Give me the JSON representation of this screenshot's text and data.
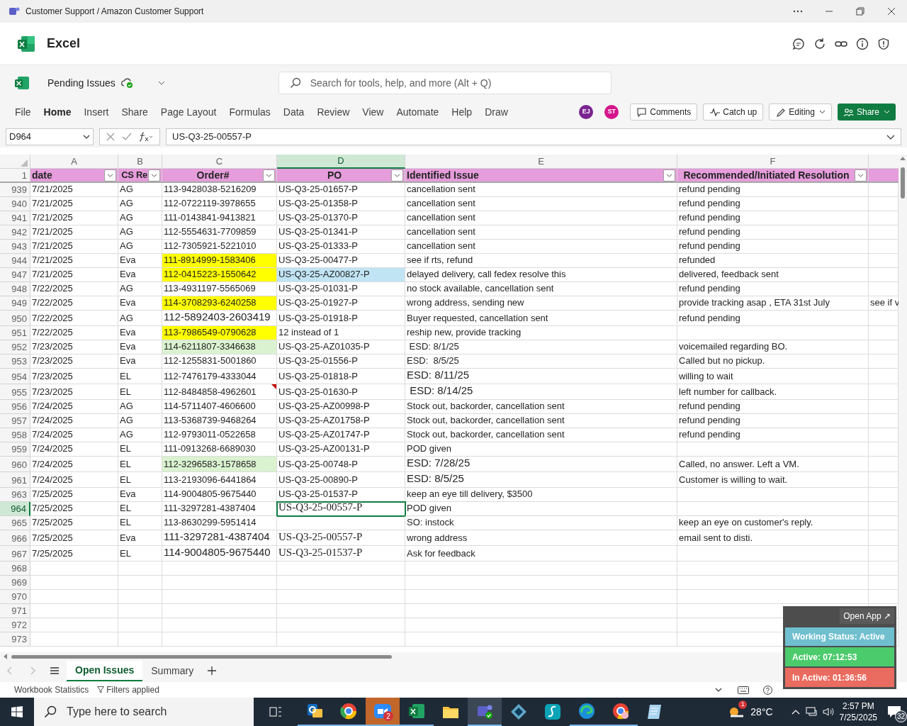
{
  "title_bar": {
    "title": "Customer Support / Amazon Customer Support"
  },
  "app": {
    "name": "Excel"
  },
  "document": {
    "name": "Pending Issues"
  },
  "search": {
    "placeholder": "Search for tools, help, and more (Alt + Q)"
  },
  "menu": [
    {
      "label": "File",
      "selected": false
    },
    {
      "label": "Home",
      "selected": true
    },
    {
      "label": "Insert",
      "selected": false
    },
    {
      "label": "Share",
      "selected": false
    },
    {
      "label": "Page Layout",
      "selected": false
    },
    {
      "label": "Formulas",
      "selected": false
    },
    {
      "label": "Data",
      "selected": false
    },
    {
      "label": "Review",
      "selected": false
    },
    {
      "label": "View",
      "selected": false
    },
    {
      "label": "Automate",
      "selected": false
    },
    {
      "label": "Help",
      "selected": false
    },
    {
      "label": "Draw",
      "selected": false
    }
  ],
  "collaborators": [
    {
      "initials": "EJ",
      "color": "#7a2491"
    },
    {
      "initials": "ST",
      "color": "#d4168c"
    }
  ],
  "actions": [
    {
      "kind": "comments",
      "label": "Comments"
    },
    {
      "kind": "catchup",
      "label": "Catch up"
    },
    {
      "kind": "editing",
      "label": "Editing"
    },
    {
      "kind": "share",
      "label": "Share"
    }
  ],
  "formula_bar": {
    "name_box": "D964",
    "formula": "US-Q3-25-00557-P"
  },
  "sheet": {
    "column_letters": [
      {
        "label": "A",
        "selected": false
      },
      {
        "label": "B",
        "selected": false
      },
      {
        "label": "C",
        "selected": false
      },
      {
        "label": "D",
        "selected": true
      },
      {
        "label": "E",
        "selected": false
      },
      {
        "label": "F",
        "selected": false
      }
    ],
    "header_row": "1",
    "headers": [
      "date",
      "CS Re",
      "Order#",
      "PO",
      "Identified Issue",
      "Recommended/Initiated Resolution"
    ],
    "rows": [
      {
        "number": "939",
        "selected": false,
        "cells": [
          "7/21/2025",
          "AG",
          "113-9428038-5216209",
          "US-Q3-25-01657-P",
          "cancellation sent",
          "refund pending",
          null
        ]
      },
      {
        "number": "940",
        "selected": false,
        "cells": [
          "7/21/2025",
          "AG",
          "112-0722119-3978655",
          "US-Q3-25-01358-P",
          "cancellation sent",
          "refund pending",
          null
        ]
      },
      {
        "number": "941",
        "selected": false,
        "cells": [
          "7/21/2025",
          "AG",
          "111-0143841-9413821",
          "US-Q3-25-01370-P",
          "cancellation sent",
          "refund pending",
          null
        ]
      },
      {
        "number": "942",
        "selected": false,
        "cells": [
          "7/21/2025",
          "AG",
          "112-5554631-7709859",
          "US-Q3-25-01341-P",
          "cancellation sent",
          "refund pending",
          null
        ]
      },
      {
        "number": "943",
        "selected": false,
        "cells": [
          "7/21/2025",
          "AG",
          "112-7305921-5221010",
          "US-Q3-25-01333-P",
          "cancellation sent",
          "refund pending",
          null
        ]
      },
      {
        "number": "944",
        "selected": false,
        "cells": [
          "7/21/2025",
          "Eva",
          {
            "text": "111-8914999-1583406",
            "color": "#ffff00"
          },
          "US-Q3-25-00477-P",
          "see if rts, refund",
          "refunded",
          null
        ]
      },
      {
        "number": "947",
        "selected": false,
        "cells": [
          "7/21/2025",
          "Eva",
          {
            "text": "112-0415223-1550642",
            "color": "#ffff00"
          },
          {
            "text": "US-Q3-25-AZ00827-P",
            "color": "#c1e4f5"
          },
          "delayed delivery, call fedex resolve this",
          "delivered, feedback sent",
          null
        ]
      },
      {
        "number": "948",
        "selected": false,
        "cells": [
          "7/22/2025",
          "AG",
          "113-4931197-5565069",
          "US-Q3-25-01031-P",
          "no stock available, cancellation sent",
          "refund pending",
          null
        ]
      },
      {
        "number": "949",
        "selected": false,
        "cells": [
          "7/22/2025",
          "Eva",
          {
            "text": "114-3708293-6240258",
            "color": "#ffff00"
          },
          "US-Q3-25-01927-P",
          "wrong address, sending new",
          "provide tracking asap , ETA 31st July",
          "see if v"
        ]
      },
      {
        "number": "950",
        "selected": false,
        "cells": [
          "7/22/2025",
          "AG",
          {
            "text": "112-5892403-2603419",
            "kind": "large"
          },
          "US-Q3-25-01918-P",
          "Buyer requested, cancellation sent",
          "refund pending",
          null
        ]
      },
      {
        "number": "951",
        "selected": false,
        "cells": [
          "7/22/2025",
          "Eva",
          {
            "text": "113-7986549-0790628",
            "color": "#ffff00"
          },
          "12 instead of 1",
          "reship new, provide tracking",
          null,
          null
        ]
      },
      {
        "number": "952",
        "selected": false,
        "cells": [
          "7/23/2025",
          "Eva",
          {
            "text": "114-6211807-3346638",
            "color": "#daf2d0"
          },
          "US-Q3-25-AZ01035-P",
          " ESD: 8/1/25",
          "voicemailed regarding BO.",
          null
        ]
      },
      {
        "number": "953",
        "selected": false,
        "cells": [
          "7/23/2025",
          "Eva",
          "112-1255831-5001860",
          "US-Q3-25-01556-P",
          "ESD:  8/5/25",
          "Called but no pickup.",
          null
        ]
      },
      {
        "number": "954",
        "selected": false,
        "cells": [
          "7/23/2025",
          "EL",
          "112-7476179-4333044",
          "US-Q3-25-01818-P",
          {
            "text": "ESD: 8/11/25",
            "kind": "large"
          },
          "willing to wait",
          null
        ]
      },
      {
        "number": "955",
        "selected": false,
        "cells": [
          "7/23/2025",
          "EL",
          {
            "text": "112-8484858-4962601",
            "comment": true
          },
          "US-Q3-25-01630-P",
          {
            "text": " ESD: 8/14/25",
            "kind": "large"
          },
          "left number for callback.",
          null
        ]
      },
      {
        "number": "956",
        "selected": false,
        "cells": [
          "7/24/2025",
          "AG",
          "114-5711407-4606600",
          "US-Q3-25-AZ00998-P",
          "Stock out, backorder, cancellation sent",
          "refund pending",
          null
        ]
      },
      {
        "number": "957",
        "selected": false,
        "cells": [
          "7/24/2025",
          "AG",
          "113-5368739-9468264",
          "US-Q3-25-AZ01758-P",
          "Stock out, backorder, cancellation sent",
          "refund pending",
          null
        ]
      },
      {
        "number": "958",
        "selected": false,
        "cells": [
          "7/24/2025",
          "AG",
          "112-9793011-0522658",
          "US-Q3-25-AZ01747-P",
          "Stock out, backorder, cancellation sent",
          "refund pending",
          null
        ]
      },
      {
        "number": "959",
        "selected": false,
        "cells": [
          "7/24/2025",
          "EL",
          "111-0913268-6689030",
          "US-Q3-25-AZ00131-P",
          "POD given",
          null,
          null
        ]
      },
      {
        "number": "960",
        "selected": false,
        "cells": [
          "7/24/2025",
          "EL",
          {
            "text": "112-3296583-1578658",
            "color": "#daf2d0"
          },
          "US-Q3-25-00748-P",
          {
            "text": "ESD: 7/28/25",
            "kind": "large"
          },
          "Called, no answer. Left a VM.",
          null
        ]
      },
      {
        "number": "961",
        "selected": false,
        "cells": [
          "7/24/2025",
          "EL",
          "113-2193096-6441864",
          "US-Q3-25-00890-P",
          {
            "text": "ESD: 8/5/25",
            "kind": "large"
          },
          "Customer is willing to wait.",
          null
        ]
      },
      {
        "number": "963",
        "selected": false,
        "cells": [
          "7/25/2025",
          "Eva",
          "114-9004805-9675440",
          "US-Q3-25-01537-P",
          "keep an eye till delivery, $3500",
          null,
          null
        ]
      },
      {
        "number": "964",
        "selected": true,
        "cells": [
          "7/25/2025",
          "EL",
          "111-3297281-4387404",
          {
            "text": "US-Q3-25-00557-P",
            "kind": "serif",
            "selected": true
          },
          "POD given",
          null,
          null
        ]
      },
      {
        "number": "965",
        "selected": false,
        "cells": [
          "7/25/2025",
          "EL",
          "113-8630299-5951414",
          null,
          "SO: instock",
          "keep an eye on customer's reply.",
          null
        ]
      },
      {
        "number": "966",
        "selected": false,
        "cells": [
          "7/25/2025",
          "Eva",
          {
            "text": "111-3297281-4387404",
            "kind": "large"
          },
          {
            "text": "US-Q3-25-00557-P",
            "kind": "serif"
          },
          "wrong address",
          "email sent to disti.",
          null
        ]
      },
      {
        "number": "967",
        "selected": false,
        "cells": [
          "7/25/2025",
          "EL",
          {
            "text": "114-9004805-9675440",
            "kind": "large"
          },
          {
            "text": "US-Q3-25-01537-P",
            "kind": "serif"
          },
          "Ask for feedback",
          null,
          null
        ]
      }
    ],
    "empty_rows": [
      "968",
      "969",
      "970",
      "971",
      "972",
      "973"
    ]
  },
  "sheet_tabs": [
    {
      "label": "Open Issues",
      "selected": true
    },
    {
      "label": "Summary",
      "selected": false
    }
  ],
  "status_bar": {
    "items": [
      "Workbook Statistics",
      "Filters applied"
    ]
  },
  "tracker": {
    "open_app": "Open App ↗",
    "status": "Working Status: Active",
    "active": "Active: 07:12:53",
    "inactive": "In Active: 01:36:56"
  },
  "taskbar": {
    "search_placeholder": "Type here to search",
    "zoom_badge": "2",
    "weather_badge": "1",
    "temperature": "28°C",
    "time": "2:57 PM",
    "date": "7/25/2025",
    "notifications": "32"
  }
}
